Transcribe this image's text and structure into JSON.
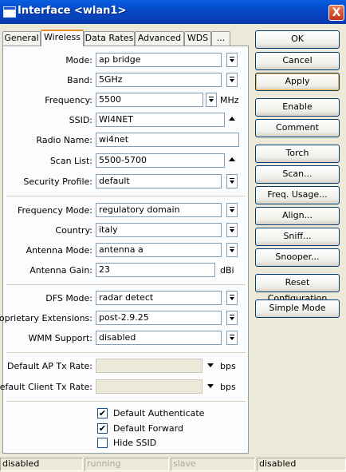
{
  "window": {
    "title": "Interface <wlan1>",
    "close_label": "X"
  },
  "tabs": [
    {
      "label": "General"
    },
    {
      "label": "Wireless",
      "active": true
    },
    {
      "label": "Data Rates"
    },
    {
      "label": "Advanced"
    },
    {
      "label": "WDS"
    },
    {
      "label": "..."
    }
  ],
  "form": {
    "mode": {
      "label": "Mode:",
      "value": "ap bridge"
    },
    "band": {
      "label": "Band:",
      "value": "5GHz"
    },
    "frequency": {
      "label": "Frequency:",
      "value": "5500",
      "unit": "MHz"
    },
    "ssid": {
      "label": "SSID:",
      "value": "WI4NET"
    },
    "radio_name": {
      "label": "Radio Name:",
      "value": "wi4net"
    },
    "scan_list": {
      "label": "Scan List:",
      "value": "5500-5700"
    },
    "security_profile": {
      "label": "Security Profile:",
      "value": "default"
    },
    "frequency_mode": {
      "label": "Frequency Mode:",
      "value": "regulatory domain"
    },
    "country": {
      "label": "Country:",
      "value": "italy"
    },
    "antenna_mode": {
      "label": "Antenna Mode:",
      "value": "antenna a"
    },
    "antenna_gain": {
      "label": "Antenna Gain:",
      "value": "23",
      "unit": "dBi"
    },
    "dfs_mode": {
      "label": "DFS Mode:",
      "value": "radar detect"
    },
    "proprietary_extensions": {
      "label": "Proprietary Extensions:",
      "value": "post-2.9.25"
    },
    "wmm_support": {
      "label": "WMM Support:",
      "value": "disabled"
    },
    "default_ap_tx_rate": {
      "label": "Default AP Tx Rate:",
      "value": "",
      "unit": "bps"
    },
    "default_client_tx_rate": {
      "label": "Default Client Tx Rate:",
      "value": "",
      "unit": "bps"
    },
    "default_authenticate": {
      "label": "Default Authenticate",
      "checked": true,
      "mark": "✔"
    },
    "default_forward": {
      "label": "Default Forward",
      "checked": true,
      "mark": "✔"
    },
    "hide_ssid": {
      "label": "Hide SSID",
      "checked": false,
      "mark": ""
    }
  },
  "buttons": {
    "ok": "OK",
    "cancel": "Cancel",
    "apply": "Apply",
    "enable": "Enable",
    "comment": "Comment",
    "torch": "Torch",
    "scan": "Scan...",
    "freq_usage": "Freq. Usage...",
    "align": "Align...",
    "sniff": "Sniff...",
    "snooper": "Snooper...",
    "reset_configuration": "Reset Configuration",
    "simple_mode": "Simple Mode"
  },
  "status": [
    "disabled",
    "running",
    "slave",
    "disabled"
  ],
  "colors": {
    "titlebar": "#0a5fe0",
    "close": "#c5351a",
    "tab_active_accent": "#e68b2c"
  }
}
